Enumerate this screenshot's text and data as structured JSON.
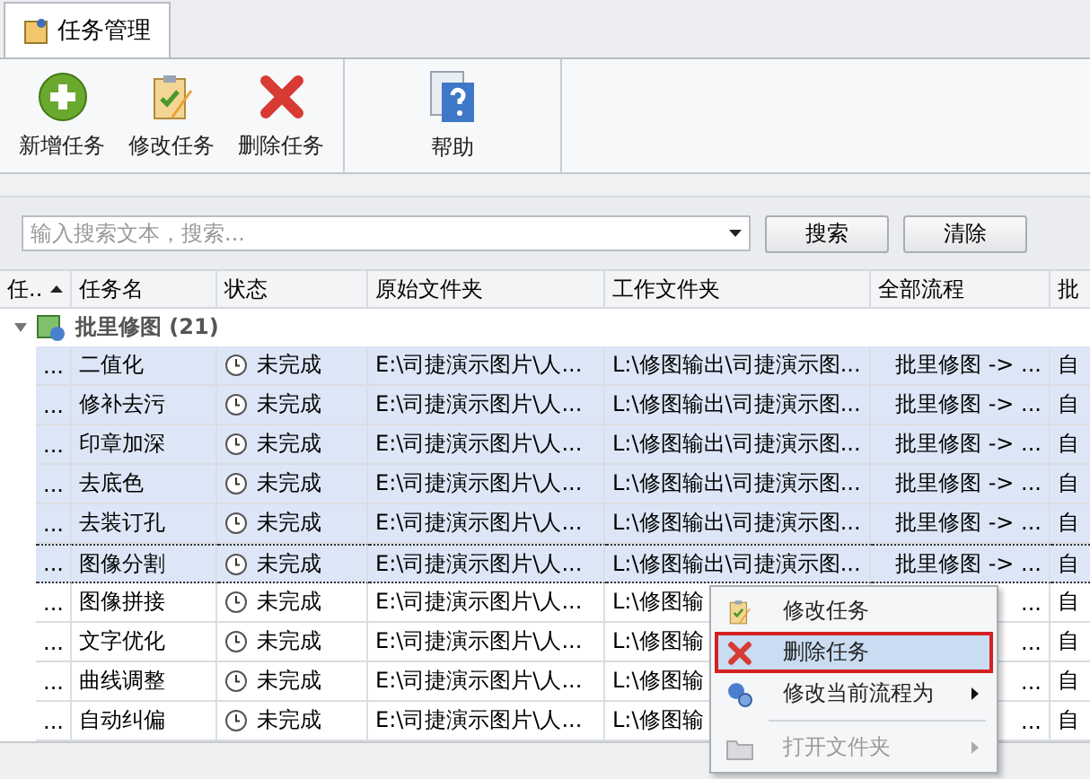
{
  "tabs": [
    {
      "label": "任务管理",
      "selected": true
    }
  ],
  "ribbon": {
    "groups": [
      {
        "buttons": [
          {
            "label": "新增任务",
            "kind": "add"
          },
          {
            "label": "修改任务",
            "kind": "edit"
          },
          {
            "label": "删除任务",
            "kind": "delete"
          }
        ]
      },
      {
        "buttons": [
          {
            "label": "帮助",
            "kind": "help"
          }
        ]
      }
    ]
  },
  "search": {
    "placeholder": "输入搜索文本，搜索...",
    "buttons": [
      "搜索",
      "清除"
    ]
  },
  "table": {
    "columns": [
      "任..",
      "任务名",
      "状态",
      "原始文件夹",
      "工作文件夹",
      "全部流程",
      "批"
    ],
    "group": {
      "label": "批里修图 (21)",
      "expanded": true
    },
    "rows": [
      {
        "id": "...",
        "name": "二值化",
        "status": "未完成",
        "source": "E:\\司捷演示图片\\人...",
        "work": "L:\\修图输出\\司捷演示图...",
        "flow": "批里修图 -> ...",
        "extra": "自",
        "selected": true,
        "focused": false
      },
      {
        "id": "...",
        "name": "修补去污",
        "status": "未完成",
        "source": "E:\\司捷演示图片\\人...",
        "work": "L:\\修图输出\\司捷演示图...",
        "flow": "批里修图 -> ...",
        "extra": "自",
        "selected": true,
        "focused": false
      },
      {
        "id": "...",
        "name": "印章加深",
        "status": "未完成",
        "source": "E:\\司捷演示图片\\人...",
        "work": "L:\\修图输出\\司捷演示图...",
        "flow": "批里修图 -> ...",
        "extra": "自",
        "selected": true,
        "focused": false
      },
      {
        "id": "...",
        "name": "去底色",
        "status": "未完成",
        "source": "E:\\司捷演示图片\\人...",
        "work": "L:\\修图输出\\司捷演示图...",
        "flow": "批里修图 -> ...",
        "extra": "自",
        "selected": true,
        "focused": false
      },
      {
        "id": "...",
        "name": "去装订孔",
        "status": "未完成",
        "source": "E:\\司捷演示图片\\人...",
        "work": "L:\\修图输出\\司捷演示图...",
        "flow": "批里修图 -> ...",
        "extra": "自",
        "selected": true,
        "focused": false
      },
      {
        "id": "...",
        "name": "图像分割",
        "status": "未完成",
        "source": "E:\\司捷演示图片\\人...",
        "work": "L:\\修图输出\\司捷演示图...",
        "flow": "批里修图 -> ...",
        "extra": "自",
        "selected": true,
        "focused": true
      },
      {
        "id": "...",
        "name": "图像拼接",
        "status": "未完成",
        "source": "E:\\司捷演示图片\\人...",
        "work": "L:\\修图输",
        "flow": "...",
        "extra": "自",
        "selected": false,
        "focused": false
      },
      {
        "id": "...",
        "name": "文字优化",
        "status": "未完成",
        "source": "E:\\司捷演示图片\\人...",
        "work": "L:\\修图输",
        "flow": "...",
        "extra": "自",
        "selected": false,
        "focused": false
      },
      {
        "id": "...",
        "name": "曲线调整",
        "status": "未完成",
        "source": "E:\\司捷演示图片\\人...",
        "work": "L:\\修图输",
        "flow": "...",
        "extra": "自",
        "selected": false,
        "focused": false
      },
      {
        "id": "...",
        "name": "自动纠偏",
        "status": "未完成",
        "source": "E:\\司捷演示图片\\人...",
        "work": "L:\\修图输",
        "flow": "...",
        "extra": "自",
        "selected": false,
        "focused": false
      }
    ]
  },
  "context_menu": {
    "items": [
      {
        "label": "修改任务",
        "kind": "edit",
        "selected": false,
        "disabled": false,
        "submenu": false
      },
      {
        "label": "删除任务",
        "kind": "delete",
        "selected": true,
        "disabled": false,
        "submenu": false
      },
      {
        "label": "修改当前流程为",
        "kind": "flow",
        "selected": false,
        "disabled": false,
        "submenu": true
      },
      {
        "label": "打开文件夹",
        "kind": "folder",
        "selected": false,
        "disabled": true,
        "submenu": true
      }
    ]
  }
}
